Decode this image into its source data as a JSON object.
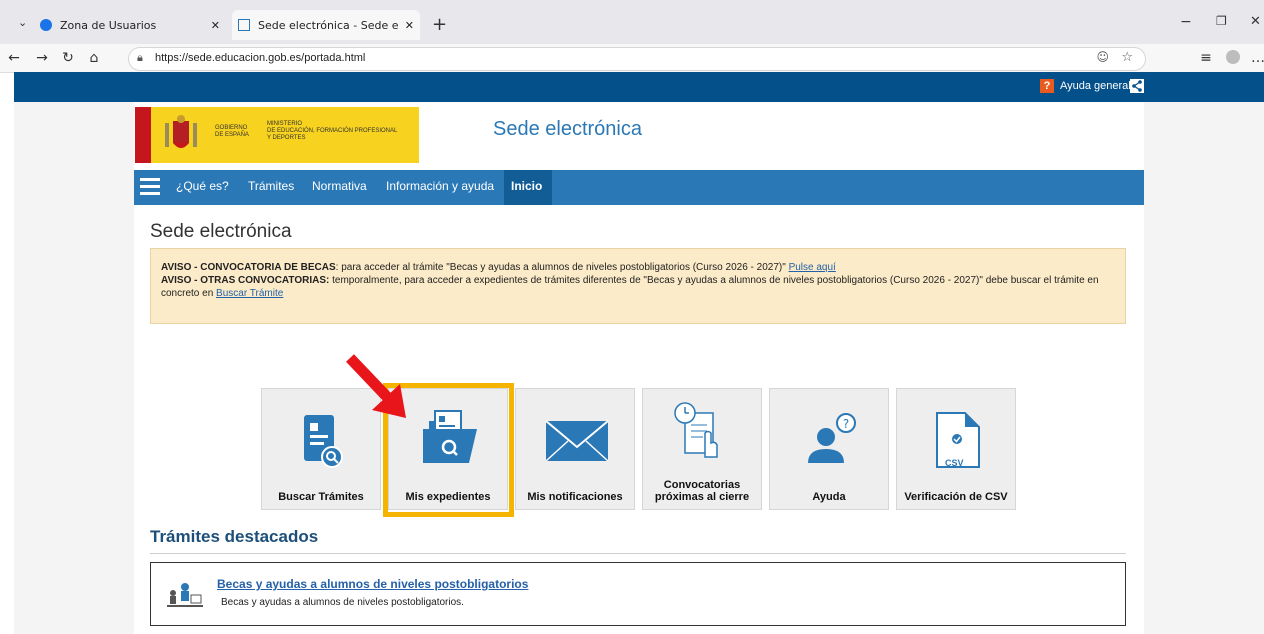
{
  "browser": {
    "tabs": [
      {
        "title": "Zona de Usuarios"
      },
      {
        "title": "Sede electrónica - Sede electrónica"
      }
    ],
    "url": "https://sede.educacion.gob.es/portada.html",
    "new_tab_glyph": "+",
    "window_controls": {
      "minimize": "−",
      "restore": "❐",
      "close": "✕"
    }
  },
  "site": {
    "help_label": "Ayuda general",
    "logo": {
      "gobierno": "GOBIERNO\nDE ESPAÑA",
      "ministerio": "MINISTERIO\nDE EDUCACIÓN, FORMACIÓN PROFESIONAL\nY DEPORTES"
    },
    "title": "Sede electrónica",
    "menu": [
      "¿Qué es?",
      "Trámites",
      "Normativa",
      "Información y ayuda",
      "Inicio"
    ],
    "page_title": "Sede electrónica",
    "notice": {
      "line1_bold": "AVISO - CONVOCATORIA DE BECAS",
      "line1_text": ": para acceder al trámite \"Becas y ayudas a alumnos de niveles postobligatorios (Curso 2026 - 2027)\" ",
      "line1_link": "Pulse aquí",
      "line2_bold": "AVISO - OTRAS CONVOCATORIAS:",
      "line2_text": " temporalmente, para acceder a expedientes de trámites diferentes de \"Becas y ayudas a alumnos de niveles postobligatorios (Curso 2026 - 2027)\" debe buscar el trámite en concreto en ",
      "line2_link": "Buscar Trámite"
    },
    "tiles": [
      {
        "label": "Buscar Trámites"
      },
      {
        "label": "Mis expedientes"
      },
      {
        "label": "Mis notificaciones"
      },
      {
        "label": "Convocatorias\npróximas al cierre"
      },
      {
        "label": "Ayuda"
      },
      {
        "label": "Verificación de CSV"
      }
    ],
    "csv_badge": "CSV",
    "featured_title": "Trámites destacados",
    "featured": {
      "link": "Becas y ayudas a alumnos de niveles postobligatorios",
      "desc": "Becas y ayudas a alumnos de niveles postobligatorios."
    },
    "colors": {
      "brand": "#2b78b6",
      "highlight": "#f5b400",
      "arrow": "#e8161b"
    }
  }
}
